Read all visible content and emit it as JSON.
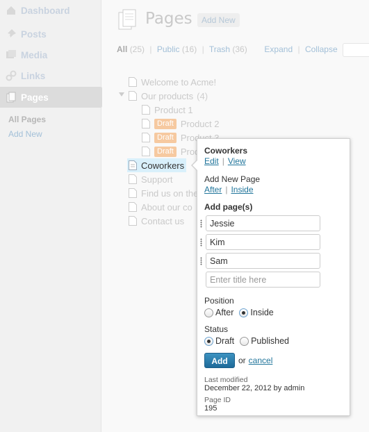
{
  "sidebar": {
    "items": [
      {
        "label": "Dashboard",
        "icon": "dashboard-icon"
      },
      {
        "label": "Posts",
        "icon": "pin-icon"
      },
      {
        "label": "Media",
        "icon": "media-icon"
      },
      {
        "label": "Links",
        "icon": "link-icon"
      },
      {
        "label": "Pages",
        "icon": "pages-icon",
        "current": true
      }
    ],
    "submenu": {
      "all_pages": "All Pages",
      "add_new": "Add New"
    }
  },
  "header": {
    "title": "Pages",
    "add_new": "Add New"
  },
  "filters": {
    "all": {
      "label": "All",
      "count": "(25)"
    },
    "public": {
      "label": "Public",
      "count": "(16)"
    },
    "trash": {
      "label": "Trash",
      "count": "(36)"
    },
    "expand": "Expand",
    "collapse": "Collapse",
    "separator": "|"
  },
  "tree": {
    "welcome": "Welcome to Acme!",
    "our_products": "Our products",
    "our_products_count": "(4)",
    "product1": "Product 1",
    "product2": "Product 2",
    "product3": "Product 3",
    "product4": "Prod",
    "draft": "Draft",
    "coworkers": "Coworkers",
    "support": "Support",
    "find_us": "Find us on the",
    "about": "About our co",
    "contact": "Contact us"
  },
  "popover": {
    "title": "Coworkers",
    "edit": "Edit",
    "view": "View",
    "link_sep": "|",
    "add_new_page": "Add New Page",
    "after": "After",
    "inside": "Inside",
    "add_pages": "Add page(s)",
    "page_values": [
      "Jessie",
      "Kim",
      "Sam"
    ],
    "new_placeholder": "Enter title here",
    "position_label": "Position",
    "position_after": "After",
    "position_inside": "Inside",
    "status_label": "Status",
    "status_draft": "Draft",
    "status_published": "Published",
    "add_button": "Add",
    "or": "or",
    "cancel": "cancel",
    "last_modified_label": "Last modified",
    "last_modified_value": "December 22, 2012 by admin",
    "page_id_label": "Page ID",
    "page_id_value": "195"
  },
  "colors": {
    "accent": "#21759b",
    "draft_badge": "#f6c9a0",
    "selected_row": "#d9f0fb"
  }
}
